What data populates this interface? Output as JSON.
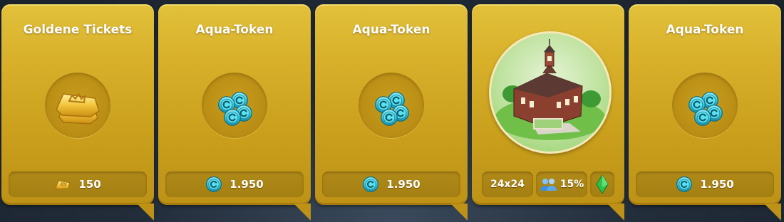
{
  "cards": [
    {
      "title": "Goldene Tickets",
      "icon": "golden-ticket-icon",
      "price_icon": "golden-ticket-icon",
      "price": "150"
    },
    {
      "title": "Aqua-Token",
      "icon": "aqua-token-stack-icon",
      "price_icon": "aqua-token-icon",
      "price": "1.950"
    },
    {
      "title": "Aqua-Token",
      "icon": "aqua-token-stack-icon",
      "price_icon": "aqua-token-icon",
      "price": "1.950"
    },
    {
      "title": "",
      "icon": "mansion-building-image",
      "size": "24x24",
      "population": "15%",
      "extra_icon": "sims-plumbob-icon"
    },
    {
      "title": "Aqua-Token",
      "icon": "aqua-token-stack-icon",
      "price_icon": "aqua-token-icon",
      "price": "1.950"
    }
  ],
  "colors": {
    "card_gold": "#d8b02a",
    "pill": "#a47f12",
    "aqua": "#3fd8e6",
    "green_gem": "#2ec24a"
  }
}
